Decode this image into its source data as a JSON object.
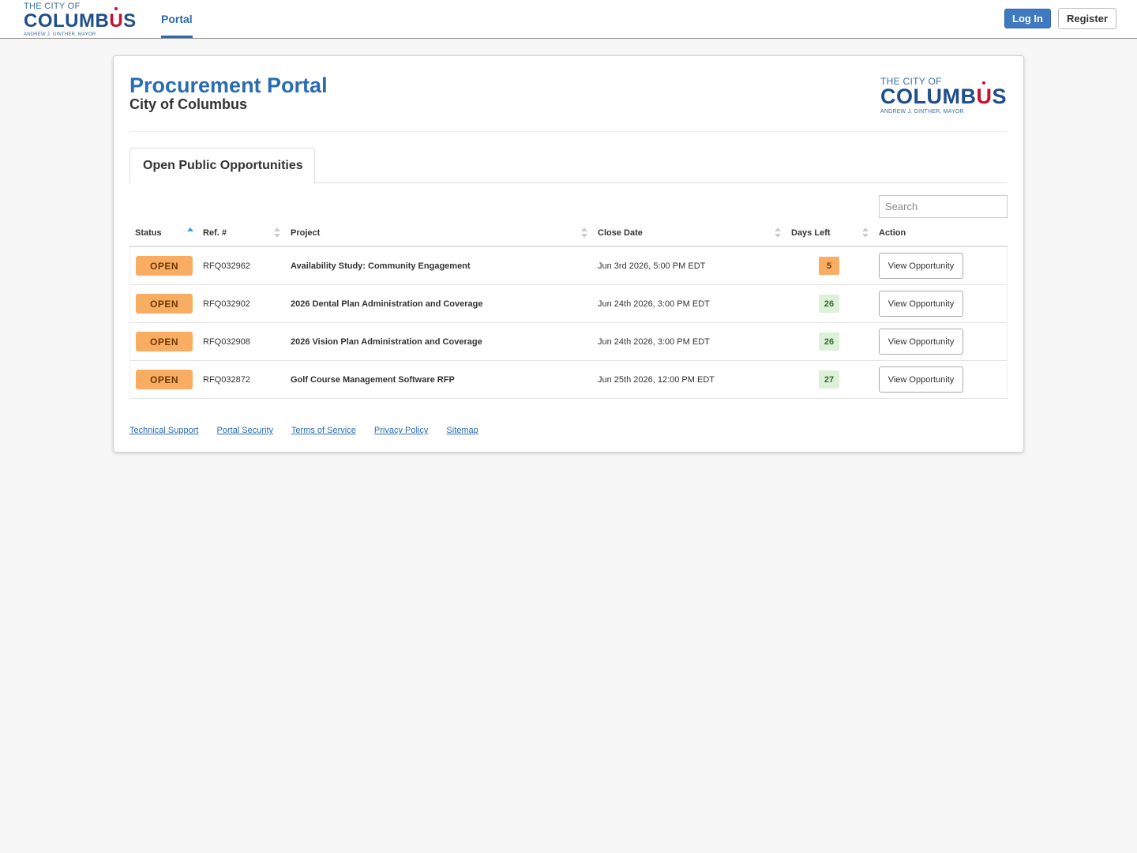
{
  "header": {
    "logo": {
      "line1": "THE CITY OF",
      "line2_blue": "COLUMB",
      "line2_red": "U",
      "line2_blue_end": "S",
      "line3": "ANDREW J. GINTHER, MAYOR"
    },
    "nav_item": "Portal",
    "login_label": "Log In",
    "register_label": "Register",
    "colors": {
      "accent": "#2a6cb2",
      "brand_red": "#c8102e",
      "brand_blue": "#1f4e8c"
    }
  },
  "card": {
    "title": "Procurement Portal",
    "subtitle": "City of Columbus",
    "tab_label": "Open Public Opportunities",
    "search_placeholder": "Search"
  },
  "table": {
    "columns": [
      "Status",
      "Ref. #",
      "Project",
      "Close Date",
      "Days Left",
      "Action"
    ],
    "sort": {
      "column": "Status",
      "direction": "asc"
    },
    "rows": [
      {
        "status": "OPEN",
        "ref": "RFQ032962",
        "project": "Availability Study: Community Engagement",
        "close_date": "Jun 3rd 2026, 5:00 PM EDT",
        "days_left": "5",
        "days_state": "warn",
        "action": "View Opportunity"
      },
      {
        "status": "OPEN",
        "ref": "RFQ032902",
        "project": "2026 Dental Plan Administration and Coverage",
        "close_date": "Jun 24th 2026, 3:00 PM EDT",
        "days_left": "26",
        "days_state": "ok",
        "action": "View Opportunity"
      },
      {
        "status": "OPEN",
        "ref": "RFQ032908",
        "project": "2026 Vision Plan Administration and Coverage",
        "close_date": "Jun 24th 2026, 3:00 PM EDT",
        "days_left": "26",
        "days_state": "ok",
        "action": "View Opportunity"
      },
      {
        "status": "OPEN",
        "ref": "RFQ032872",
        "project": "Golf Course Management Software RFP",
        "close_date": "Jun 25th 2026, 12:00 PM EDT",
        "days_left": "27",
        "days_state": "ok",
        "action": "View Opportunity"
      }
    ],
    "status_color": "#f9ad62"
  },
  "footer": {
    "links": [
      "Technical Support",
      "Portal Security",
      "Terms of Service",
      "Privacy Policy",
      "Sitemap"
    ]
  }
}
